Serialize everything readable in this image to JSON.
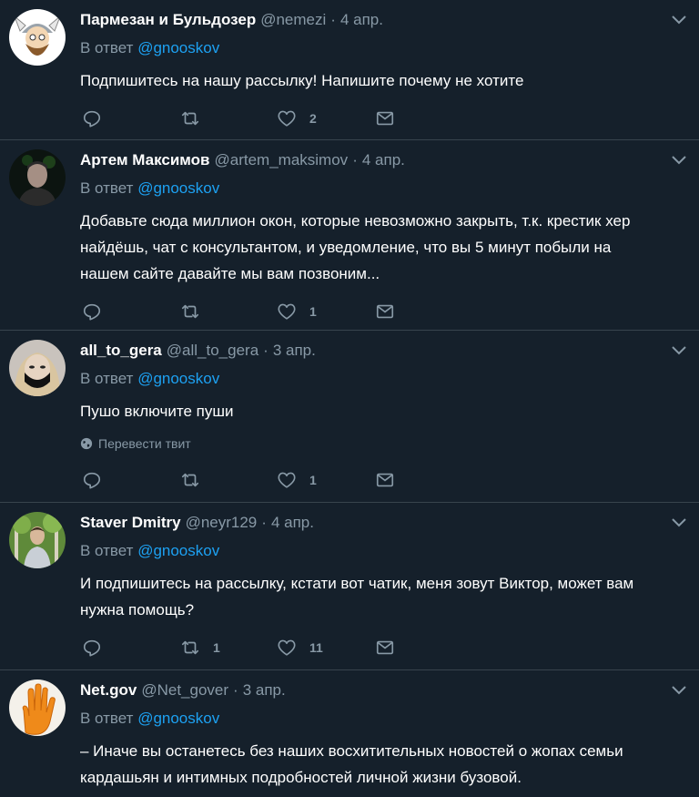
{
  "tweets": [
    {
      "name": "Пармезан и Бульдозер",
      "handle": "@nemezi",
      "date": "4 апр.",
      "reply_prefix": "В ответ",
      "reply_to": "@gnooskov",
      "text": [
        "Подпишитесь на нашу рассылку! Напишите почему не хотите"
      ],
      "translate": "",
      "retweets": "",
      "likes": "2",
      "avatar_icon": "cartoon-viking-avatar"
    },
    {
      "name": "Артем Максимов",
      "handle": "@artem_maksimov",
      "date": "4 апр.",
      "reply_prefix": "В ответ",
      "reply_to": "@gnooskov",
      "text": [
        "Добавьте сюда миллион окон, которые невозможно закрыть, т.к. крестик хер",
        "найдёшь, чат с консультантом, и уведомление, что вы 5 минут побыли на",
        "нашем сайте давайте мы вам позвоним..."
      ],
      "translate": "",
      "retweets": "",
      "likes": "1",
      "avatar_icon": "person-night-avatar"
    },
    {
      "name": "all_to_gera",
      "handle": "@all_to_gera",
      "date": "3 апр.",
      "reply_prefix": "В ответ",
      "reply_to": "@gnooskov",
      "text": [
        "Пушо включите пуши"
      ],
      "translate": "Перевести твит",
      "retweets": "",
      "likes": "1",
      "avatar_icon": "masked-person-avatar"
    },
    {
      "name": "Staver Dmitry",
      "handle": "@neyr129",
      "date": "4 апр.",
      "reply_prefix": "В ответ",
      "reply_to": "@gnooskov",
      "text": [
        "И подпишитесь на рассылку, кстати вот чатик, меня зовут Виктор, может вам",
        "нужна помощь?"
      ],
      "translate": "",
      "retweets": "1",
      "likes": "11",
      "avatar_icon": "person-forest-avatar"
    },
    {
      "name": "Net.gov",
      "handle": "@Net_gover",
      "date": "3 апр.",
      "reply_prefix": "В ответ",
      "reply_to": "@gnooskov",
      "text": [
        "– Иначе вы останетесь без наших восхитительных новостей о жопах семьи",
        "кардашьян и интимных подробностей личной жизни бузовой."
      ],
      "translate": "",
      "retweets": "",
      "likes": "",
      "avatar_icon": "orange-hand-avatar"
    }
  ],
  "colors": {
    "background": "#15202b",
    "divider": "#38444d",
    "muted": "#8899a6",
    "link": "#1da1f2",
    "text": "#ffffff"
  }
}
